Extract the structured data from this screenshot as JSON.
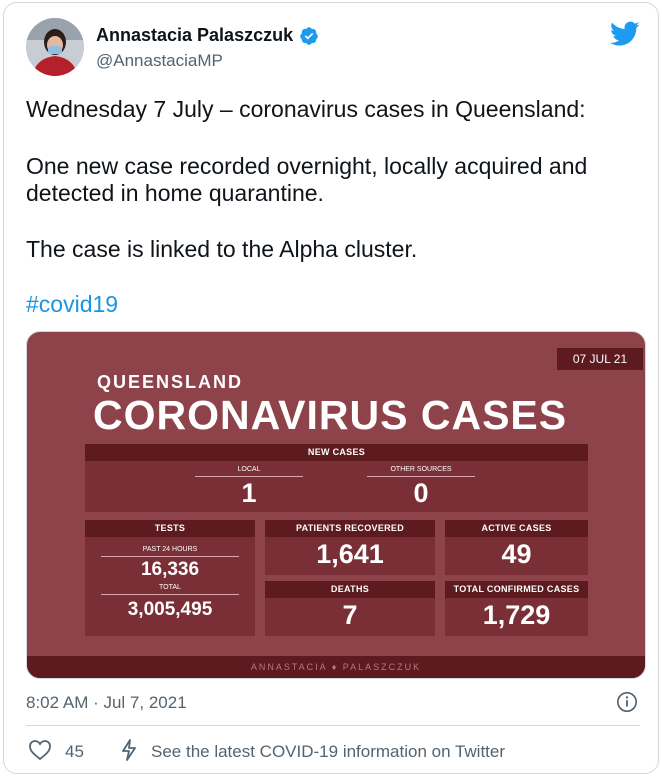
{
  "author": {
    "name": "Annastacia Palaszczuk",
    "handle": "@AnnastaciaMP"
  },
  "tweet": {
    "line1": "Wednesday 7 July – coronavirus cases in Queensland:",
    "line2": "One new case recorded overnight, locally acquired and detected in home quarantine.",
    "line3": "The case is linked to the Alpha cluster.",
    "hashtag": "#covid19"
  },
  "graphic": {
    "date": "07 JUL 21",
    "subtitle": "QUEENSLAND",
    "title": "CORONAVIRUS CASES",
    "new_cases": {
      "header": "NEW CASES",
      "local_label": "LOCAL",
      "local_value": "1",
      "other_label": "OTHER SOURCES",
      "other_value": "0"
    },
    "tests": {
      "header": "TESTS",
      "past24_label": "PAST 24 HOURS",
      "past24_value": "16,336",
      "total_label": "TOTAL",
      "total_value": "3,005,495"
    },
    "recovered": {
      "header": "PATIENTS RECOVERED",
      "value": "1,641"
    },
    "active": {
      "header": "ACTIVE CASES",
      "value": "49"
    },
    "deaths": {
      "header": "DEATHS",
      "value": "7"
    },
    "confirmed": {
      "header": "TOTAL CONFIRMED CASES",
      "value": "1,729"
    },
    "footer": "ANNASTACIA ♦ PALASZCZUK"
  },
  "meta": {
    "timestamp": "8:02 AM · Jul 7, 2021",
    "likes": "45",
    "covid_link": "See the latest COVID-19 information on Twitter"
  },
  "colors": {
    "graphic_bg": "#8e434b",
    "panel_bg": "#7a2f37",
    "panel_header": "#5d1a1f",
    "link": "#1b95e0",
    "twitter_blue": "#1d9bf0"
  }
}
